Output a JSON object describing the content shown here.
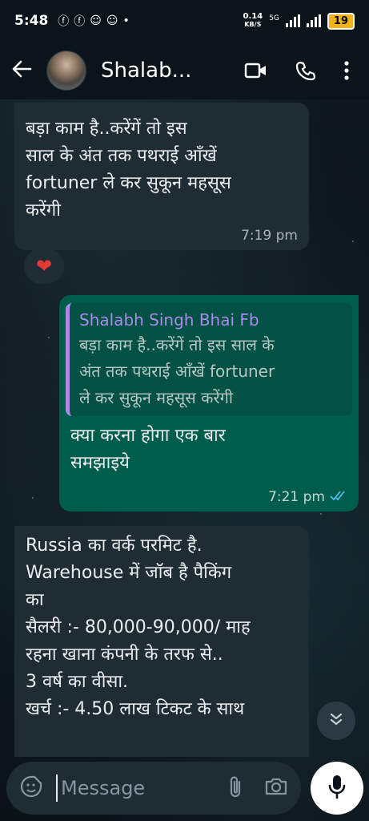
{
  "status": {
    "time": "5:48",
    "net_speed_value": "0.14",
    "net_speed_unit": "KB/S",
    "network": "5G",
    "battery": "19"
  },
  "header": {
    "contact_name": "Shalab...",
    "icons": [
      "back-arrow-icon",
      "video-call-icon",
      "phone-icon",
      "more-vert-icon"
    ]
  },
  "messages": [
    {
      "direction": "incoming",
      "lines": [
        "बड़ा काम है..करेंगें तो इस",
        "साल के अंत तक पथराई आँखें",
        "fortuner ले कर सुकून महसूस",
        "करेंगी"
      ],
      "time": "7:19 pm",
      "reaction": "❤"
    },
    {
      "direction": "outgoing",
      "quote_name": "Shalabh Singh Bhai Fb",
      "quote_lines": [
        "बड़ा काम है..करेंगें तो इस साल के",
        "अंत तक पथराई आँखें fortuner",
        "ले कर सुकून महसूस करेंगी"
      ],
      "lines": [
        "क्या करना होगा एक बार",
        "समझाइये"
      ],
      "time": "7:21 pm"
    },
    {
      "direction": "incoming",
      "lines": [
        "Russia का वर्क परमिट है.",
        "Warehouse में जॉब है पैकिंग",
        "का",
        "सैलरी :- 80,000-90,000/ माह",
        "रहना खाना कंपनी के तरफ से..",
        "3 वर्ष का वीसा.",
        "खर्च :- 4.50 लाख टिकट के साथ"
      ]
    }
  ],
  "composer": {
    "placeholder": "Message"
  },
  "colors": {
    "incoming_bubble": "#202c33",
    "outgoing_bubble": "#005c4b",
    "quote_accent": "#a98be8",
    "read_ticks": "#53bdeb"
  }
}
